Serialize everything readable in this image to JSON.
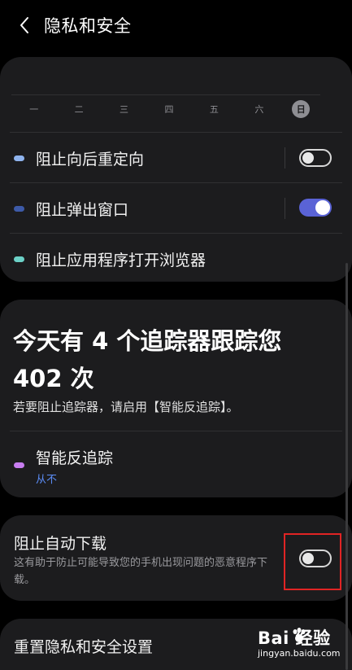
{
  "header": {
    "title": "隐私和安全",
    "back_icon": "chevron-left-icon"
  },
  "weekdays": [
    "一",
    "二",
    "三",
    "四",
    "五",
    "六",
    "日"
  ],
  "block_settings": [
    {
      "label": "阻止向后重定向",
      "dot_color": "#8fb4ee",
      "toggle": "off"
    },
    {
      "label": "阻止弹出窗口",
      "dot_color": "#3d5aa8",
      "toggle": "on"
    },
    {
      "label": "阻止应用程序打开浏览器",
      "dot_color": "#6cd1c7"
    }
  ],
  "trackers": {
    "title": "今天有 4 个追踪器跟踪您 402 次",
    "subtitle": "若要阻止追踪器，请启用【智能反追踪】。",
    "anti_tracking": {
      "label": "智能反追踪",
      "status": "从不",
      "dot_color": "#c77df0",
      "status_color": "#5b8cf5"
    }
  },
  "auto_download": {
    "title": "阻止自动下载",
    "description": "这有助于防止可能导致您的手机出现问题的恶意程序下载。",
    "toggle": "off"
  },
  "reset": {
    "label": "重置隐私和安全设置"
  },
  "watermark": {
    "logo": "Bai  经验",
    "url": "jingyan.baidu.com"
  },
  "colors": {
    "accent": "#5a63d6",
    "highlight": "#e02424",
    "card": "#1c1c1e"
  }
}
